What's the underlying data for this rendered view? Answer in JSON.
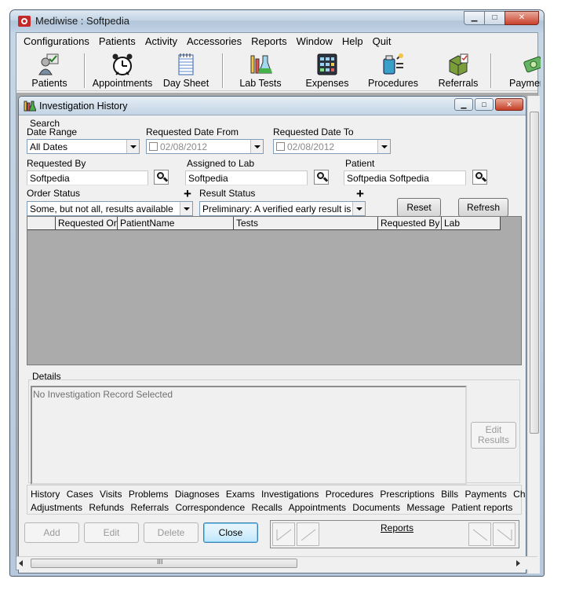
{
  "window": {
    "title": "Mediwise : Softpedia"
  },
  "menu": [
    "Configurations",
    "Patients",
    "Activity",
    "Accessories",
    "Reports",
    "Window",
    "Help",
    "Quit"
  ],
  "toolbar": [
    "Patients",
    "Appointments",
    "Day Sheet",
    "Lab Tests",
    "Expenses",
    "Procedures",
    "Referrals",
    "Payment"
  ],
  "child": {
    "title": "Investigation  History",
    "search": {
      "section": "Search",
      "date_range_label": "Date Range",
      "date_range_value": "All Dates",
      "from_label": "Requested Date From",
      "from_value": "02/08/2012",
      "to_label": "Requested Date To",
      "to_value": "02/08/2012",
      "requested_by_label": "Requested By",
      "requested_by_value": "Softpedia",
      "assigned_label": "Assigned to Lab",
      "assigned_value": "Softpedia",
      "patient_label": "Patient",
      "patient_value": "Softpedia  Softpedia",
      "order_status_label": "Order Status",
      "order_status_value": "Some, but not all, results available",
      "result_status_label": "Result Status",
      "result_status_value": "Preliminary: A verified early result is avail",
      "plus": "+",
      "reset": "Reset",
      "refresh": "Refresh"
    },
    "columns": [
      "",
      "Requested On",
      "PatientName",
      "Tests",
      "Requested By",
      "Lab"
    ],
    "details_label": "Details",
    "details_text": "No Investigation Record Selected",
    "edit_results": [
      "Edit",
      "Results"
    ],
    "links_row1": [
      "History",
      "Cases",
      "Visits",
      "Problems",
      "Diagnoses",
      "Exams",
      "Investigations",
      "Procedures",
      "Prescriptions",
      "Bills",
      "Payments",
      "Charges"
    ],
    "links_row2": [
      "Adjustments",
      "Refunds",
      "Referrals",
      "Correspondence",
      "Recalls",
      "Appointments",
      "Documents",
      "Message",
      "Patient reports"
    ],
    "buttons": {
      "add": "Add",
      "edit": "Edit",
      "delete": "Delete",
      "close": "Close"
    },
    "reports": "Reports"
  },
  "scroll_thumb_glyph": "III"
}
